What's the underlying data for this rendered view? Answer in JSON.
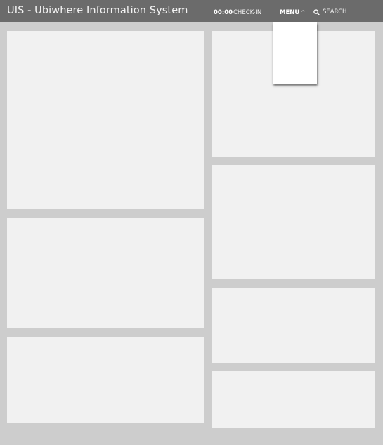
{
  "header": {
    "title": "UIS - Ubiwhere Information System",
    "clock": "00:00",
    "checkin_label": "CHECK-IN",
    "menu_label": "MENU",
    "menu_caret": "^",
    "search_label": "SEARCH",
    "search_icon": "search-icon"
  },
  "menu": {
    "expanded": true,
    "items": []
  },
  "panels": {
    "left_column_count": 3,
    "right_column_count": 4
  },
  "colors": {
    "header_background": "#6b6b6b",
    "page_background": "#cdcdcd",
    "panel_background": "#f1f1f1",
    "dropdown_background": "#ffffff"
  }
}
